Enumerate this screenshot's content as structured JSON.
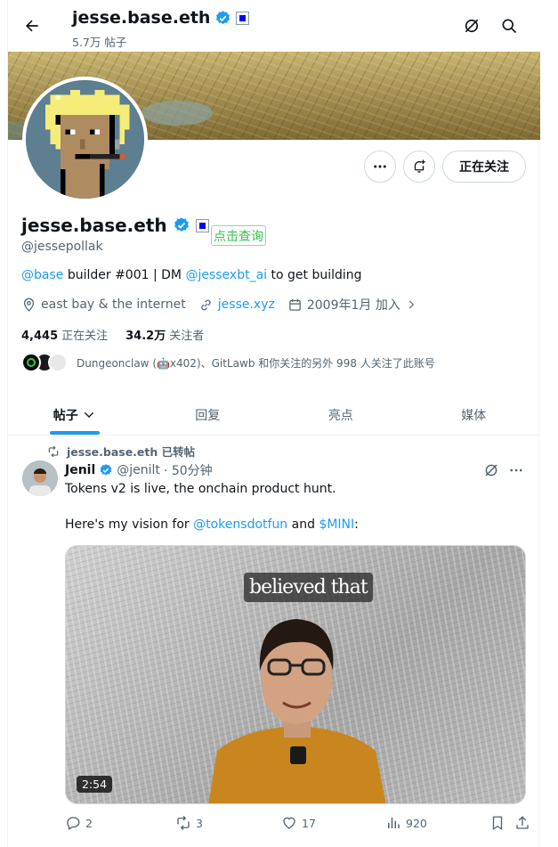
{
  "header": {
    "name": "jesse.base.eth",
    "posts_count": "5.7万 帖子"
  },
  "profile": {
    "name": "jesse.base.eth",
    "handle": "@jessepollak",
    "query_button": "点击查询",
    "follow_button": "正在关注",
    "bio": {
      "mention1": "@base",
      "text1": " builder #001 | DM ",
      "mention2": "@jessexbt_ai",
      "text2": " to get building"
    },
    "location": "east bay & the internet",
    "website": "jesse.xyz",
    "joined": "2009年1月 加入",
    "following_count": "4,445",
    "following_label": "正在关注",
    "followers_count": "34.2万",
    "followers_label": "关注者",
    "followed_by_text": "Dungeonclaw (🤖x402)、GitLawb 和你关注的另外 998 人关注了此账号"
  },
  "tabs": [
    {
      "label": "帖子"
    },
    {
      "label": "回复"
    },
    {
      "label": "亮点"
    },
    {
      "label": "媒体"
    }
  ],
  "tweet": {
    "retweet_text": "jesse.base.eth 已转帖",
    "author": "Jenil",
    "handle": "@jenilt",
    "time": "· 50分钟",
    "line1": "Tokens v2 is live, the onchain product hunt.",
    "line2_pre": "Here's my vision for ",
    "line2_mention": "@tokensdotfun",
    "line2_mid": " and ",
    "line2_cashtag": "$MINI",
    "line2_post": ":",
    "video_caption": "believed that",
    "video_duration": "2:54",
    "replies": "2",
    "retweets": "3",
    "likes": "17",
    "views": "920"
  },
  "colors": {
    "accent": "#1d9bf0",
    "verified": "#1d9bf0",
    "query_green": "#35c04c"
  }
}
